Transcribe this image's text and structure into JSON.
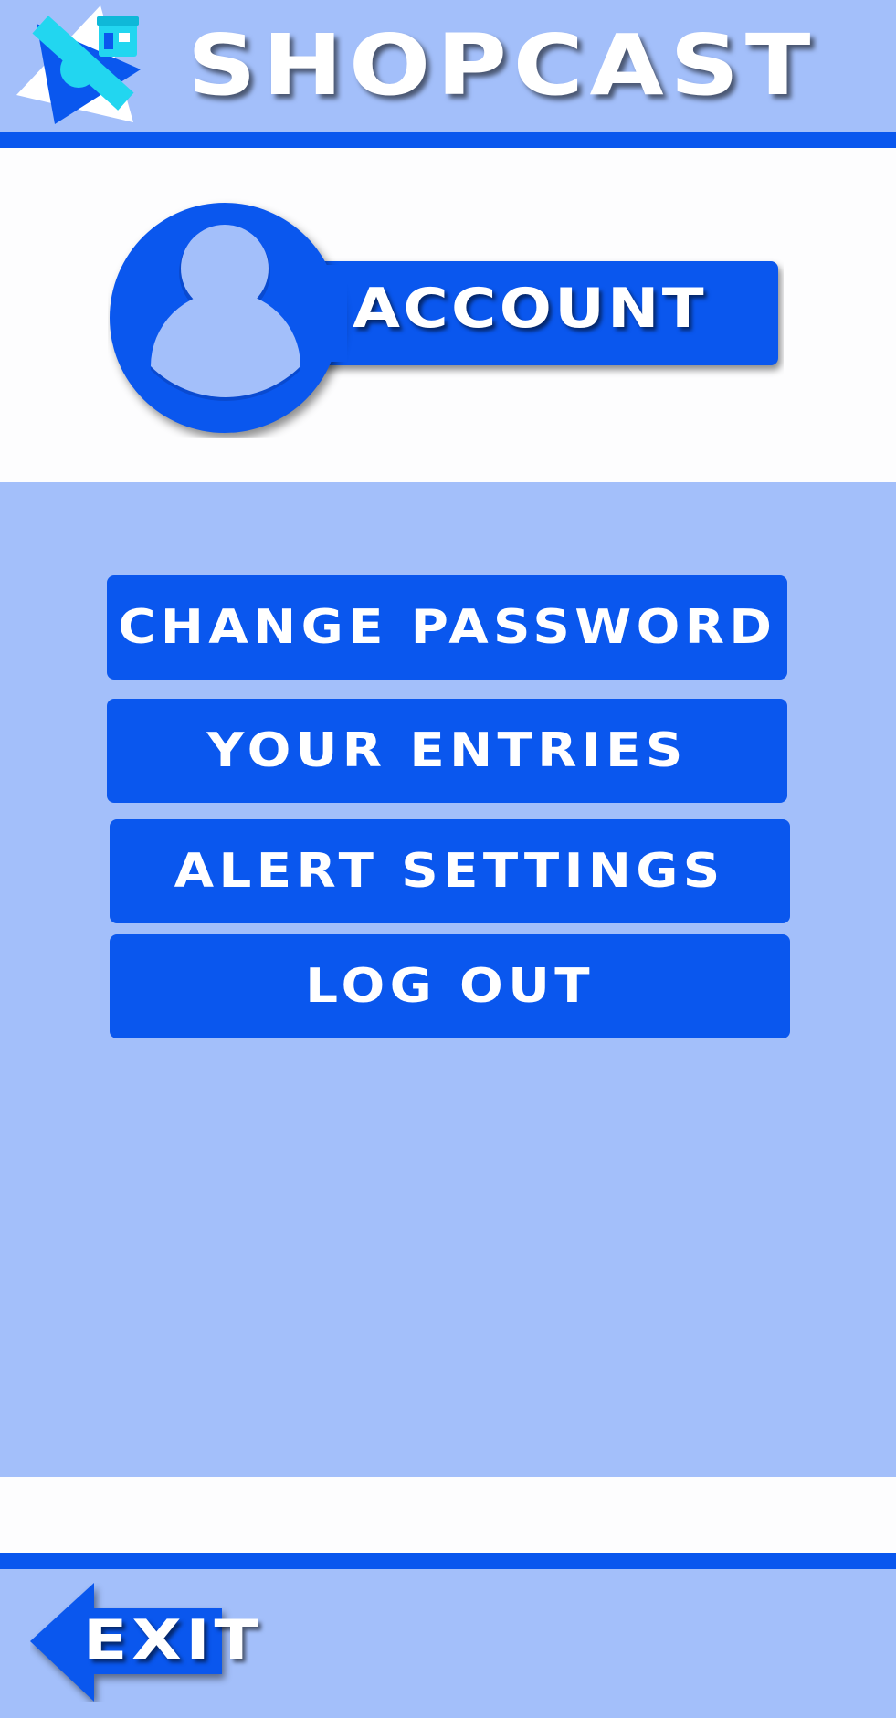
{
  "app": {
    "brand": "SHOPCAST",
    "logo_icon": "satellite-storefront-icon"
  },
  "account": {
    "title": "ACCOUNT",
    "icon": "user-avatar-icon"
  },
  "menu": {
    "items": [
      {
        "label": "CHANGE PASSWORD"
      },
      {
        "label": "YOUR ENTRIES"
      },
      {
        "label": "ALERT SETTINGS"
      },
      {
        "label": "LOG OUT"
      }
    ]
  },
  "footer": {
    "exit_label": "EXIT",
    "exit_icon": "left-arrow-icon"
  },
  "colors": {
    "background": "#a3bffa",
    "accent": "#0a57ee",
    "white_band": "#fdfdfe",
    "logo_cyan": "#22d6f0",
    "avatar_fill": "#a3bffa"
  }
}
